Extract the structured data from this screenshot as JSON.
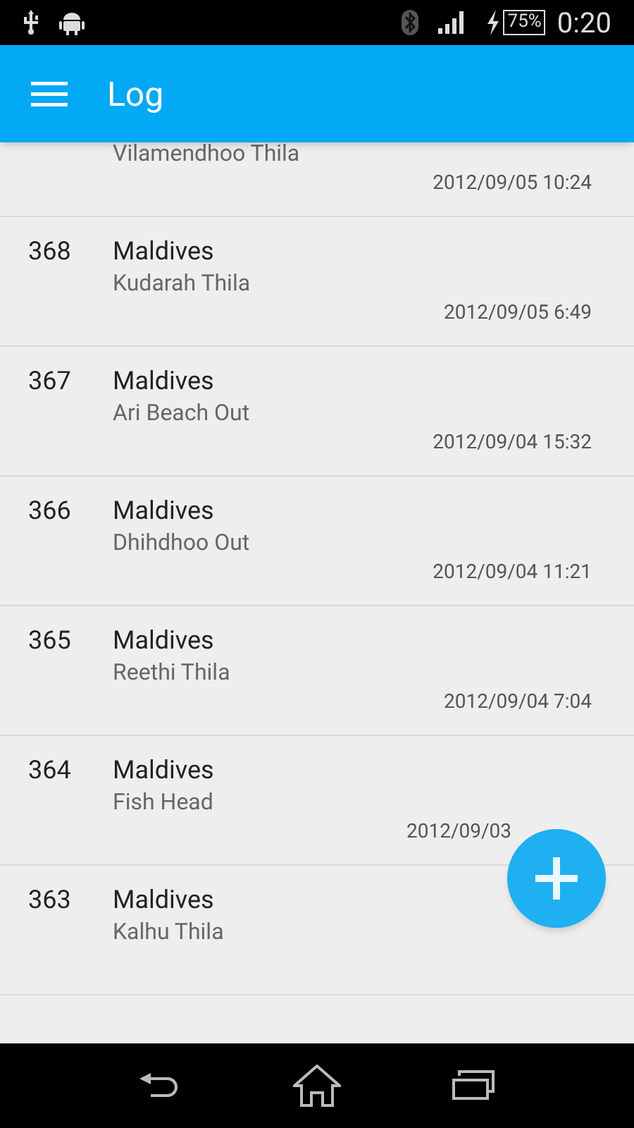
{
  "status_bar": {
    "battery": "75%",
    "time": "0:20"
  },
  "app_bar": {
    "title": "Log"
  },
  "entries": [
    {
      "site": "Vilamendhoo Thila",
      "date": "2012/09/05 10:24"
    },
    {
      "number": "368",
      "country": "Maldives",
      "site": "Kudarah Thila",
      "date": "2012/09/05 6:49"
    },
    {
      "number": "367",
      "country": "Maldives",
      "site": "Ari Beach Out",
      "date": "2012/09/04 15:32"
    },
    {
      "number": "366",
      "country": "Maldives",
      "site": "Dhihdhoo Out",
      "date": "2012/09/04 11:21"
    },
    {
      "number": "365",
      "country": "Maldives",
      "site": "Reethi Thila",
      "date": "2012/09/04 7:04"
    },
    {
      "number": "364",
      "country": "Maldives",
      "site": "Fish Head",
      "date": "2012/09/03",
      "covered": true
    },
    {
      "number": "363",
      "country": "Maldives",
      "site": "Kalhu Thila"
    }
  ]
}
